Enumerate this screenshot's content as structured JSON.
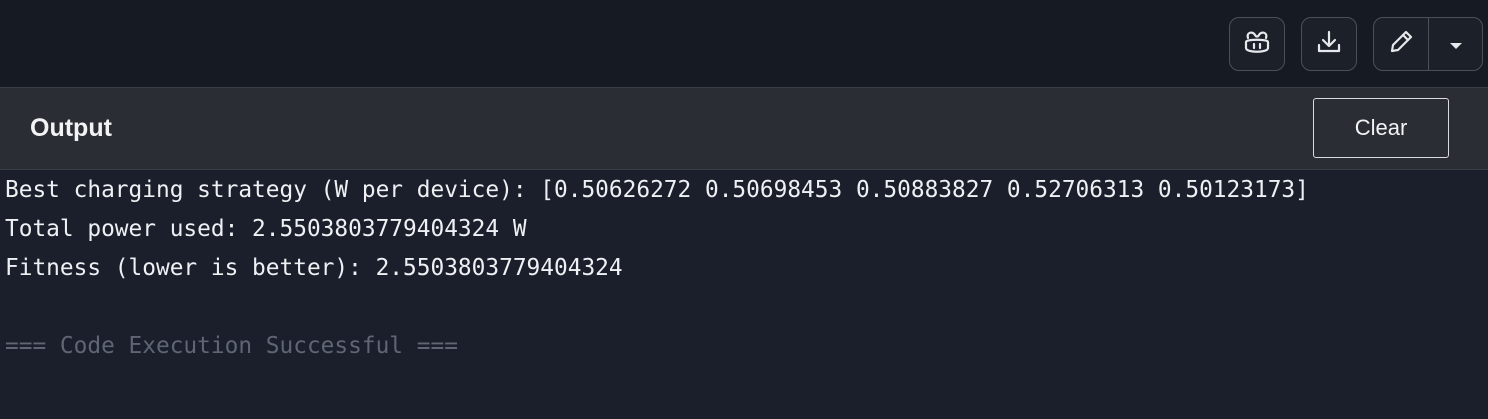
{
  "toolbar": {
    "copilot_icon": "copilot-icon",
    "download_icon": "download-icon",
    "edit_icon": "pencil-icon",
    "dropdown_icon": "caret-down-icon"
  },
  "output": {
    "title": "Output",
    "clear_label": "Clear",
    "lines": [
      "Best charging strategy (W per device): [0.50626272 0.50698453 0.50883827 0.52706313 0.50123173]",
      "Total power used: 2.5503803779404324 W",
      "Fitness (lower is better): 2.5503803779404324"
    ],
    "status": "=== Code Execution Successful ==="
  },
  "colors": {
    "top_bar": "#161a22",
    "header": "#2a2d34",
    "console_bg": "#1b1f2b",
    "text": "#eef0f3",
    "status_text": "#5f6573"
  }
}
